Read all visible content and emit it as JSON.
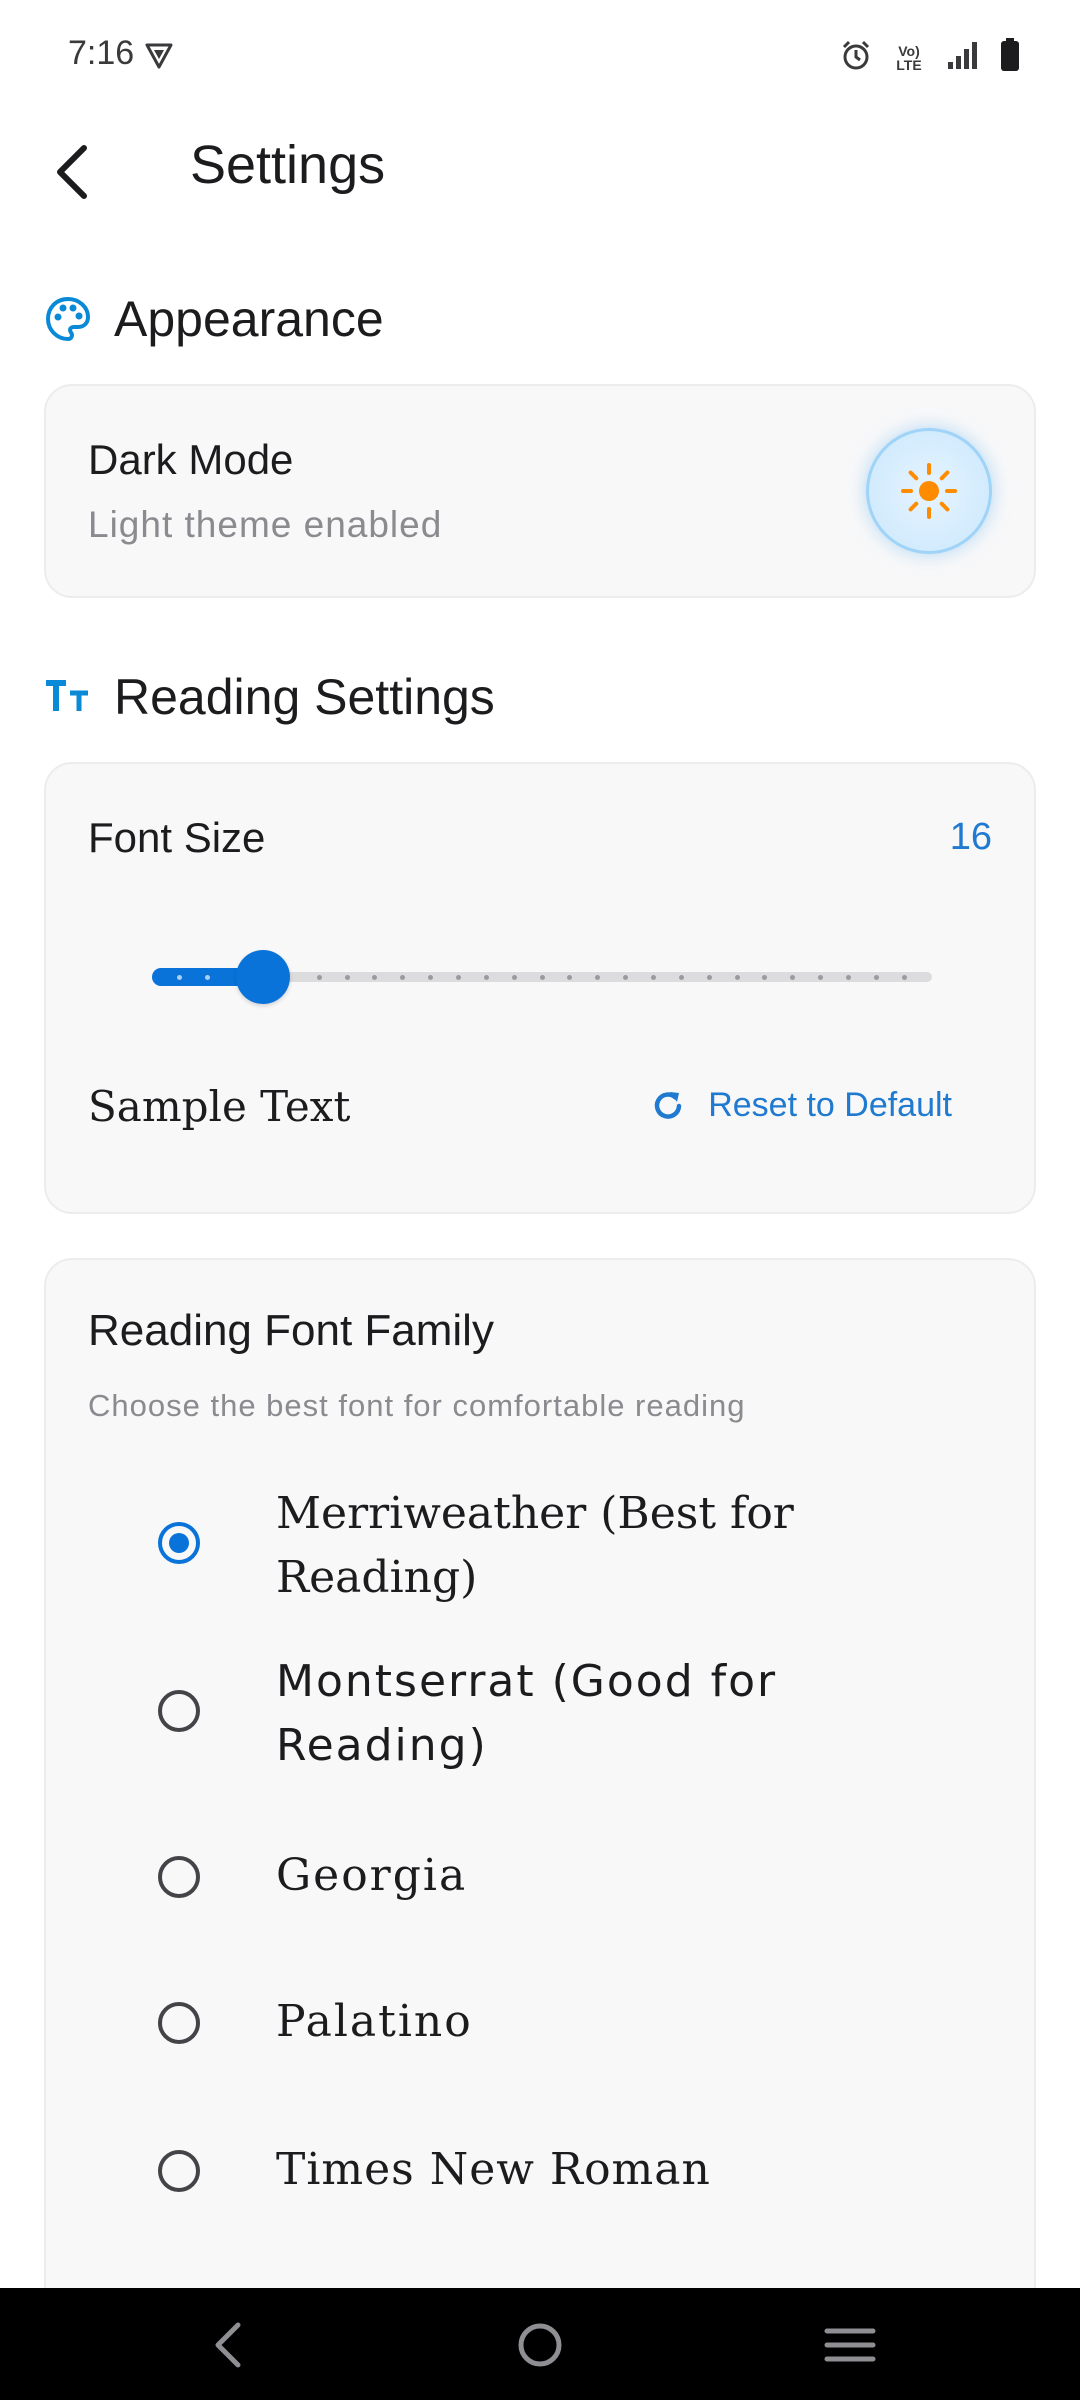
{
  "status_bar": {
    "time": "7:16",
    "icons": [
      "vpn-shield-icon",
      "alarm-icon",
      "volte-icon",
      "signal-icon",
      "battery-icon"
    ],
    "volte_text": "Vo) LTE"
  },
  "header": {
    "title": "Settings",
    "back_icon": "chevron-left-icon"
  },
  "appearance": {
    "section_title": "Appearance",
    "section_icon": "palette-icon",
    "dark_mode": {
      "title": "Dark Mode",
      "subtitle": "Light theme enabled",
      "toggle_icon": "sun-icon",
      "enabled": false
    }
  },
  "reading_settings": {
    "section_title": "Reading Settings",
    "section_icon": "text-size-icon",
    "font_size": {
      "title": "Font Size",
      "value": "16",
      "slider_min": 12,
      "slider_max": 40,
      "slider_value": 16
    },
    "sample_text": "Sample Text",
    "reset_label": "Reset to Default",
    "reset_icon": "refresh-icon"
  },
  "font_family": {
    "title": "Reading Font Family",
    "subtitle": "Choose the best font for comfortable reading",
    "options": [
      {
        "label": "Merriweather (Best for Reading)",
        "selected": true
      },
      {
        "label": "Montserrat (Good for Reading)",
        "selected": false
      },
      {
        "label": "Georgia",
        "selected": false
      },
      {
        "label": "Palatino",
        "selected": false
      },
      {
        "label": "Times New Roman",
        "selected": false
      }
    ]
  },
  "nav_bar": {
    "icons": [
      "nav-back-icon",
      "nav-home-icon",
      "nav-recents-icon"
    ]
  },
  "colors": {
    "accent": "#0a73d9",
    "link": "#1f7ad0",
    "sun": "#ff8c00",
    "card_bg": "#f8f8f9"
  }
}
